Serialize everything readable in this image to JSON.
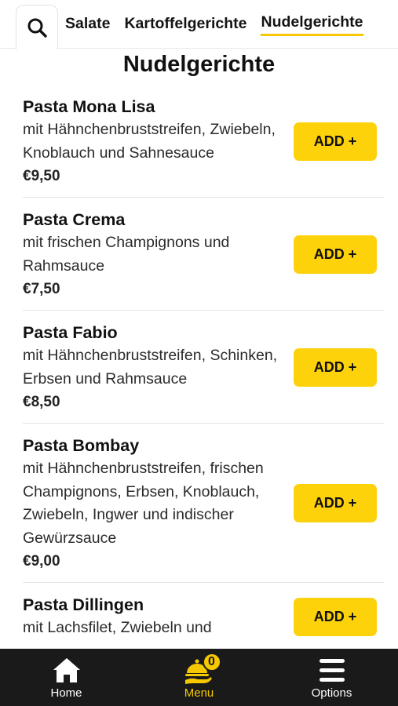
{
  "categories": {
    "tabs": [
      {
        "label": "Salate",
        "active": false
      },
      {
        "label": "Kartoffelgerichte",
        "active": false
      },
      {
        "label": "Nudelgerichte",
        "active": true
      }
    ]
  },
  "section": {
    "title": "Nudelgerichte"
  },
  "items": [
    {
      "name": "Pasta Mona Lisa",
      "description": "mit Hähnchenbruststreifen, Zwiebeln, Knoblauch und Sahnesauce",
      "price": "€9,50",
      "add_label": "ADD +"
    },
    {
      "name": "Pasta Crema",
      "description": "mit frischen Champignons und Rahmsauce",
      "price": "€7,50",
      "add_label": "ADD +"
    },
    {
      "name": "Pasta Fabio",
      "description": "mit Hähnchenbruststreifen, Schinken, Erbsen und Rahmsauce",
      "price": "€8,50",
      "add_label": "ADD +"
    },
    {
      "name": "Pasta Bombay",
      "description": "mit Hähnchenbruststreifen, frischen Champignons, Erbsen, Knoblauch, Zwiebeln, Ingwer und indischer Gewürzsauce",
      "price": "€9,00",
      "add_label": "ADD +"
    },
    {
      "name": "Pasta Dillingen",
      "description": "mit Lachsfilet, Zwiebeln und",
      "price": "",
      "add_label": "ADD +"
    }
  ],
  "nav": {
    "home": {
      "label": "Home",
      "icon": "home-icon"
    },
    "menu": {
      "label": "Menu",
      "icon": "cloche-icon",
      "badge": "0"
    },
    "options": {
      "label": "Options",
      "icon": "hamburger-icon"
    }
  },
  "colors": {
    "accent": "#f5c800",
    "button": "#fdd20a",
    "nav_bg": "#1a1a1a"
  }
}
